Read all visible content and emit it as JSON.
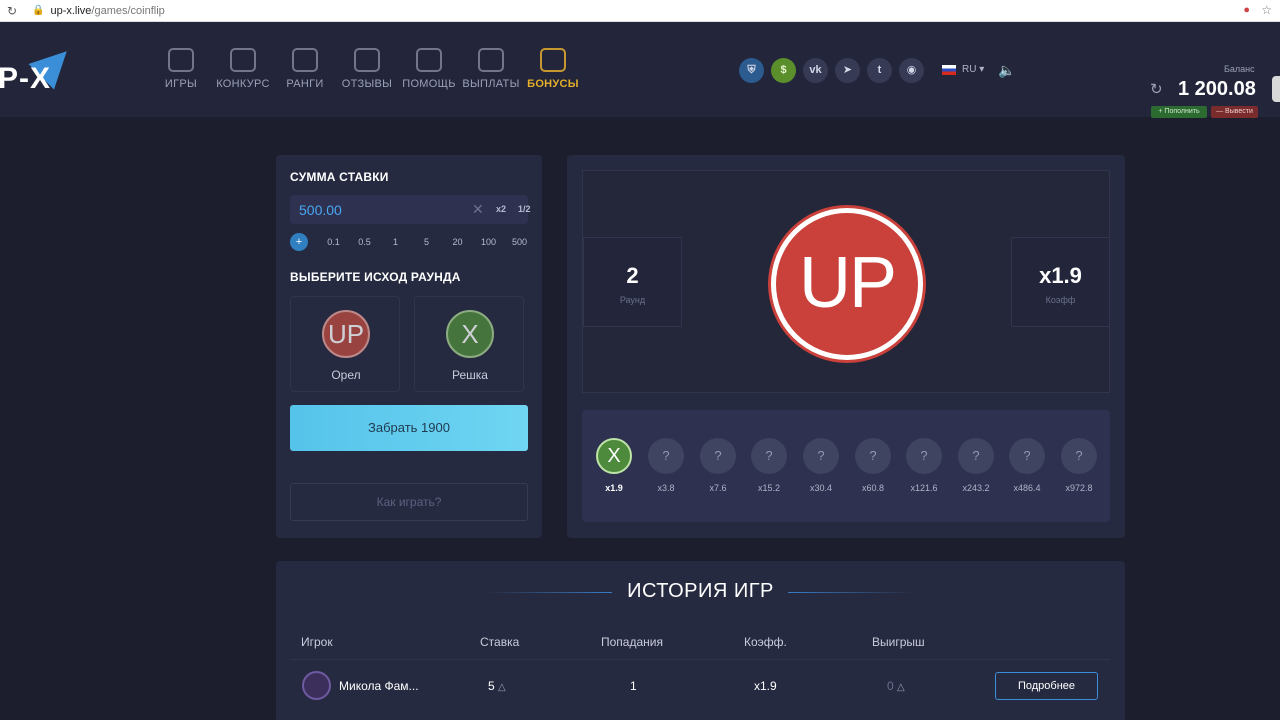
{
  "browser": {
    "url_domain": "up-x.live",
    "url_path": "/games/coinflip"
  },
  "header": {
    "logo": "P-X",
    "nav": [
      {
        "label": "ИГРЫ",
        "icon": "coins-icon",
        "active": false
      },
      {
        "label": "КОНКУРС",
        "icon": "trophy-icon",
        "active": false
      },
      {
        "label": "РАНГИ",
        "icon": "rank-icon",
        "active": false
      },
      {
        "label": "ОТЗЫВЫ",
        "icon": "reviews-icon",
        "active": false
      },
      {
        "label": "ПОМОЩЬ",
        "icon": "help-icon",
        "active": false
      },
      {
        "label": "ВЫПЛАТЫ",
        "icon": "payouts-icon",
        "active": false
      },
      {
        "label": "БОНУСЫ",
        "icon": "bonus-icon",
        "active": true
      }
    ],
    "lang": "RU",
    "balance_label": "Баланс",
    "balance": "1 200.08",
    "topup_label": "+ Пополнить",
    "withdraw_label": "— Вывести"
  },
  "bet": {
    "title": "СУММА СТАВКИ",
    "amount": "500.00",
    "x2": "x2",
    "half": "1/2",
    "quick_plus": "+",
    "quick_values": [
      "0.1",
      "0.5",
      "1",
      "5",
      "20",
      "100",
      "500"
    ],
    "outcome_title": "ВЫБЕРИТЕ ИСХОД РАУНДА",
    "orel_coin": "UP",
    "orel_label": "Орел",
    "reshka_coin": "X",
    "reshka_label": "Решка",
    "take_button": "Забрать 1900",
    "howto_button": "Как играть?"
  },
  "game": {
    "round_value": "2",
    "round_label": "Раунд",
    "coeff_value": "x1.9",
    "coeff_label": "Коэфф",
    "coin_text": "UP",
    "rounds": [
      {
        "symbol": "X",
        "mult": "x1.9",
        "done": true
      },
      {
        "symbol": "?",
        "mult": "x3.8",
        "done": false
      },
      {
        "symbol": "?",
        "mult": "x7.6",
        "done": false
      },
      {
        "symbol": "?",
        "mult": "x15.2",
        "done": false
      },
      {
        "symbol": "?",
        "mult": "x30.4",
        "done": false
      },
      {
        "symbol": "?",
        "mult": "x60.8",
        "done": false
      },
      {
        "symbol": "?",
        "mult": "x121.6",
        "done": false
      },
      {
        "symbol": "?",
        "mult": "x243.2",
        "done": false
      },
      {
        "symbol": "?",
        "mult": "x486.4",
        "done": false
      },
      {
        "symbol": "?",
        "mult": "x972.8",
        "done": false
      }
    ]
  },
  "history": {
    "title": "ИСТОРИЯ ИГР",
    "headers": {
      "player": "Игрок",
      "bet": "Ставка",
      "hits": "Попадания",
      "coeff": "Коэфф.",
      "win": "Выигрыш"
    },
    "rows": [
      {
        "player": "Микола Фам...",
        "bet": "5",
        "hits": "1",
        "coeff": "x1.9",
        "win": "0",
        "more": "Подробнее"
      }
    ]
  }
}
